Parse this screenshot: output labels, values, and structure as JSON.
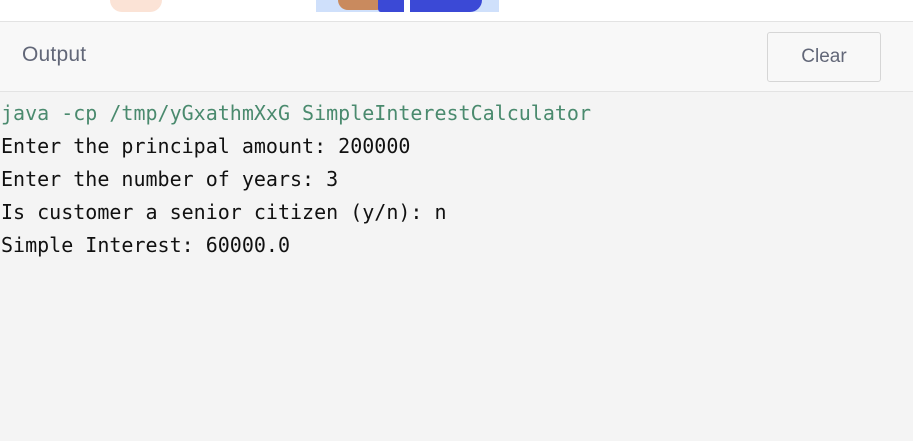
{
  "header": {
    "title": "Output",
    "clear_label": "Clear"
  },
  "console": {
    "command": "java -cp /tmp/yGxathmXxG SimpleInterestCalculator",
    "lines": [
      "Enter the principal amount: 200000",
      "Enter the number of years: 3",
      "Is customer a senior citizen (y/n): n",
      "Simple Interest: 60000.0"
    ]
  },
  "colors": {
    "command_text": "#4a8a6e",
    "output_text": "#111111",
    "console_background": "#f4f4f4",
    "header_text": "#626778"
  }
}
